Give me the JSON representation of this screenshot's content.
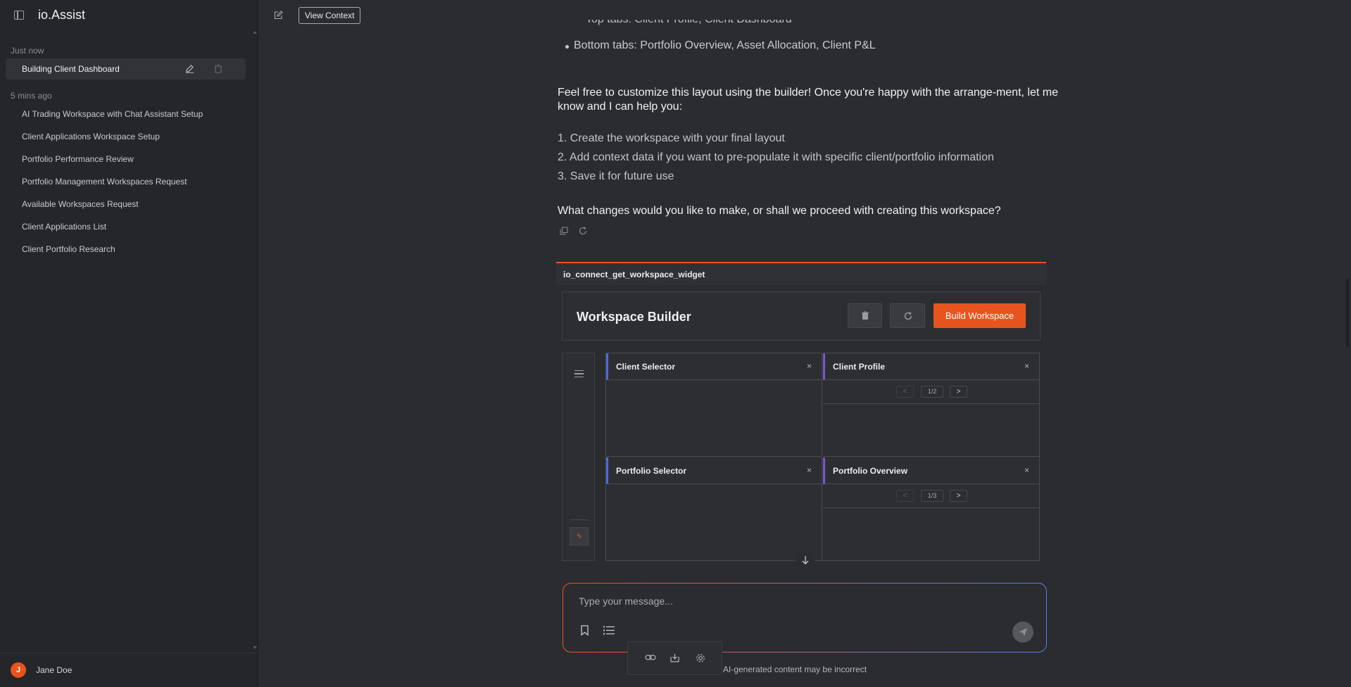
{
  "app": {
    "title": "io.Assist"
  },
  "sidebar": {
    "groups": [
      {
        "label": "Just now"
      },
      {
        "label": "5 mins ago"
      }
    ],
    "active_item": {
      "label": "Building Client Dashboard"
    },
    "items": [
      {
        "label": "AI Trading Workspace with Chat Assistant Setup"
      },
      {
        "label": "Client Applications Workspace Setup"
      },
      {
        "label": "Portfolio Performance Review"
      },
      {
        "label": "Portfolio Management Workspaces Request"
      },
      {
        "label": "Available Workspaces Request"
      },
      {
        "label": "Client Applications List"
      },
      {
        "label": "Client Portfolio Research"
      }
    ],
    "user": {
      "initial": "J",
      "name": "Jane Doe"
    }
  },
  "topbar": {
    "view_context_label": "View Context"
  },
  "conversation": {
    "cut_line": "Top tabs: Client Profile, Client Dashboard",
    "bullet": "Bottom tabs: Portfolio Overview, Asset Allocation, Client P&L",
    "paragraph1": "Feel free to customize this layout using the builder! Once you're happy with the arrange-ment, let me know and I can help you:",
    "steps": [
      "1. Create the workspace with your final layout",
      "2. Add context data if you want to pre-populate it with specific client/portfolio information",
      "3. Save it for future use"
    ],
    "question": "What changes would you like to make, or shall we proceed with creating this workspace?"
  },
  "widget": {
    "tool_name": "io_connect_get_workspace_widget",
    "builder_title": "Workspace Builder",
    "build_button": "Build Workspace",
    "rail_bolt": "ϟ",
    "panels": [
      {
        "title": "Client Selector",
        "close": "×",
        "accent": "#4a6cd8"
      },
      {
        "title": "Client Profile",
        "close": "×",
        "accent": "#7657d1",
        "pager": {
          "prev": "<",
          "count": "1/2",
          "next": ">"
        }
      },
      {
        "title": "Portfolio Selector",
        "close": "×",
        "accent": "#4a6cd8"
      },
      {
        "title": "Portfolio Overview",
        "close": "×",
        "accent": "#7657d1",
        "pager": {
          "prev": "<",
          "count": "1/3",
          "next": ">"
        }
      }
    ]
  },
  "composer": {
    "placeholder": "Type your message...",
    "disclaimer": "AI-generated content may be incorrect"
  },
  "colors": {
    "accent": "#e8541e",
    "background": "#2b2c30",
    "sidebar": "#25262a",
    "gradient_end": "#5a7ce8"
  }
}
